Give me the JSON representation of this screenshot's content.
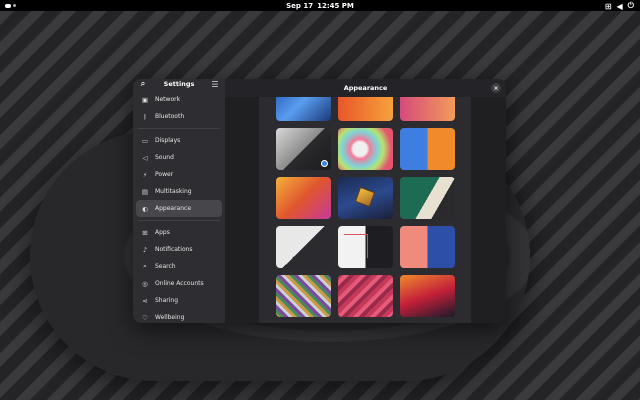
{
  "topbar": {
    "date": "Sep 17",
    "time": "12:45 PM",
    "network_icon": "network-icon",
    "volume_icon": "volume-icon",
    "power_icon": "power-icon"
  },
  "sidebar": {
    "title": "Settings",
    "items": [
      {
        "label": "Network",
        "icon": "network-icon"
      },
      {
        "label": "Bluetooth",
        "icon": "bluetooth-icon"
      },
      {
        "label": "Displays",
        "icon": "display-icon"
      },
      {
        "label": "Sound",
        "icon": "sound-icon"
      },
      {
        "label": "Power",
        "icon": "power-icon"
      },
      {
        "label": "Multitasking",
        "icon": "multitasking-icon"
      },
      {
        "label": "Appearance",
        "icon": "appearance-icon"
      },
      {
        "label": "Apps",
        "icon": "apps-icon"
      },
      {
        "label": "Notifications",
        "icon": "bell-icon"
      },
      {
        "label": "Search",
        "icon": "search-icon"
      },
      {
        "label": "Online Accounts",
        "icon": "accounts-icon"
      },
      {
        "label": "Sharing",
        "icon": "share-icon"
      },
      {
        "label": "Wellbeing",
        "icon": "wellbeing-icon"
      }
    ]
  },
  "main": {
    "title": "Appearance",
    "close_label": "×"
  },
  "colors": {
    "accent": "#3584e4",
    "sidebar_bg": "#2e2e32",
    "selected_bg": "#46464b"
  }
}
